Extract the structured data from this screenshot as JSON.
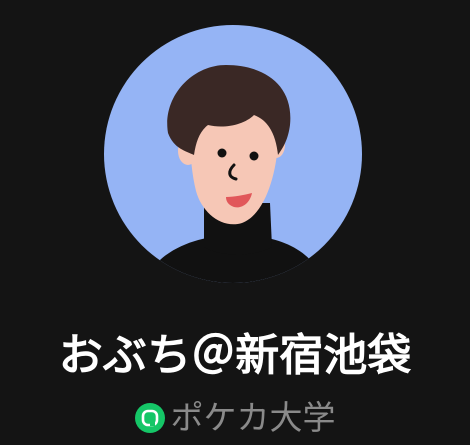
{
  "profile": {
    "display_name": "おぶち＠新宿池袋",
    "community": {
      "icon": "community-logo-icon",
      "icon_color": "#15c667",
      "label": "ポケカ大学"
    },
    "avatar": {
      "description_icon": "cartoon-person-avatar",
      "background_color": "#95b4f5"
    },
    "background_color": "#141414"
  }
}
